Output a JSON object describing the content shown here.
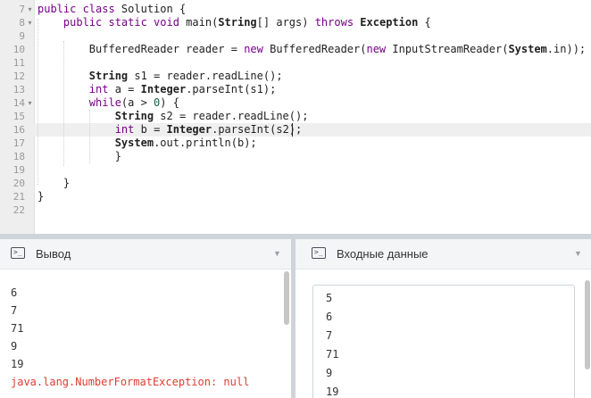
{
  "editor": {
    "line_numbers": [
      "7",
      "8",
      "9",
      "10",
      "11",
      "12",
      "13",
      "14",
      "15",
      "16",
      "17",
      "18",
      "19",
      "20",
      "21",
      "22"
    ],
    "lines": [
      [
        {
          "t": "public class",
          "c": "kw"
        },
        {
          "t": " Solution {"
        }
      ],
      [
        {
          "t": "    "
        },
        {
          "t": "public static void",
          "c": "kw"
        },
        {
          "t": " main("
        },
        {
          "t": "String",
          "c": "ty"
        },
        {
          "t": "[] args) "
        },
        {
          "t": "throws",
          "c": "kw"
        },
        {
          "t": " "
        },
        {
          "t": "Exception",
          "c": "ty"
        },
        {
          "t": " {"
        }
      ],
      [],
      [
        {
          "t": "        BufferedReader reader = "
        },
        {
          "t": "new",
          "c": "kw"
        },
        {
          "t": " BufferedReader("
        },
        {
          "t": "new",
          "c": "kw"
        },
        {
          "t": " InputStreamReader("
        },
        {
          "t": "System",
          "c": "ty"
        },
        {
          "t": ".in));"
        }
      ],
      [],
      [
        {
          "t": "        "
        },
        {
          "t": "String",
          "c": "ty"
        },
        {
          "t": " s1 = reader.readLine();"
        }
      ],
      [
        {
          "t": "        "
        },
        {
          "t": "int",
          "c": "kw"
        },
        {
          "t": " a = "
        },
        {
          "t": "Integer",
          "c": "ty"
        },
        {
          "t": ".parseInt(s1);"
        }
      ],
      [
        {
          "t": "        "
        },
        {
          "t": "while",
          "c": "kw"
        },
        {
          "t": "(a > "
        },
        {
          "t": "0",
          "c": "num"
        },
        {
          "t": ") {"
        }
      ],
      [
        {
          "t": "            "
        },
        {
          "t": "String",
          "c": "ty"
        },
        {
          "t": " s2 = reader.readLine();"
        }
      ],
      [
        {
          "t": "            "
        },
        {
          "t": "int",
          "c": "kw"
        },
        {
          "t": " b = "
        },
        {
          "t": "Integer",
          "c": "ty"
        },
        {
          "t": ".parseInt(s2);"
        }
      ],
      [
        {
          "t": "            "
        },
        {
          "t": "System",
          "c": "ty"
        },
        {
          "t": ".out.println(b);"
        }
      ],
      [
        {
          "t": "            }"
        }
      ],
      [],
      [
        {
          "t": "    }"
        }
      ],
      [
        {
          "t": "}"
        }
      ],
      []
    ],
    "active_line_index": 9,
    "fold_marker_lines": [
      "7",
      "8",
      "14"
    ]
  },
  "output_panel": {
    "title": "Вывод",
    "lines": [
      {
        "text": "6"
      },
      {
        "text": "7"
      },
      {
        "text": "71"
      },
      {
        "text": "9"
      },
      {
        "text": "19"
      },
      {
        "text": "java.lang.NumberFormatException: null",
        "error": true
      }
    ]
  },
  "input_panel": {
    "title": "Входные данные",
    "lines": [
      "5",
      "6",
      "7",
      "71",
      "9",
      "19"
    ]
  },
  "colors": {
    "keyword": "#770088",
    "number": "#116644",
    "error": "#e03c31",
    "gutter": "#eeeeee",
    "panel_header": "#f3f5f7"
  },
  "icons": {
    "panel_terminal": "terminal-icon",
    "panel_menu": "chevron-down-icon"
  }
}
